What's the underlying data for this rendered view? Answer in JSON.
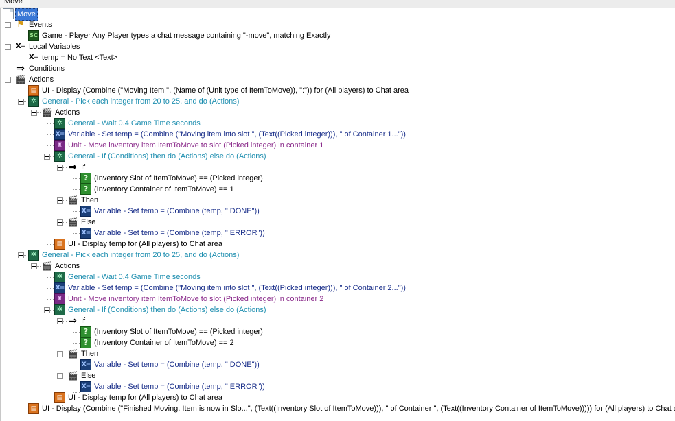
{
  "tab": {
    "label": "Move"
  },
  "tree": {
    "root": "Move",
    "events_label": "Events",
    "event_1": "Game - Player Any Player types a chat message containing \"-move\", matching Exactly",
    "local_vars_label": "Local Variables",
    "local_var_1": "temp = No Text <Text>",
    "conditions_label": "Conditions",
    "actions_label": "Actions",
    "a1": "UI - Display (Combine (\"Moving Item \", (Name of (Unit type of ItemToMove)), \":\")) for (All players) to Chat area",
    "loop1": "General - Pick each integer from 20 to 25, and do (Actions)",
    "loop1_actions": "Actions",
    "loop1_wait": "General - Wait 0.4 Game Time seconds",
    "loop1_set": "Variable - Set temp = (Combine (\"Moving item into slot \", (Text((Picked integer))), \" of Container 1...\"))",
    "loop1_move": "Unit - Move inventory item ItemToMove to slot (Picked integer) in container 1",
    "loop1_if": "General - If (Conditions) then do (Actions) else do (Actions)",
    "loop1_if_label": "If",
    "loop1_cond1": "(Inventory Slot of ItemToMove) == (Picked integer)",
    "loop1_cond2": "(Inventory Container of ItemToMove) == 1",
    "loop1_then_label": "Then",
    "loop1_then_set": "Variable - Set temp = (Combine (temp, \" DONE\"))",
    "loop1_else_label": "Else",
    "loop1_else_set": "Variable - Set temp = (Combine (temp, \" ERROR\"))",
    "loop1_display": "UI - Display temp for (All players) to Chat area",
    "loop2": "General - Pick each integer from 20 to 25, and do (Actions)",
    "loop2_actions": "Actions",
    "loop2_wait": "General - Wait 0.4 Game Time seconds",
    "loop2_set": "Variable - Set temp = (Combine (\"Moving item into slot \", (Text((Picked integer))), \" of Container 2...\"))",
    "loop2_move": "Unit - Move inventory item ItemToMove to slot (Picked integer) in container 2",
    "loop2_if": "General - If (Conditions) then do (Actions) else do (Actions)",
    "loop2_if_label": "If",
    "loop2_cond1": "(Inventory Slot of ItemToMove) == (Picked integer)",
    "loop2_cond2": "(Inventory Container of ItemToMove) == 2",
    "loop2_then_label": "Then",
    "loop2_then_set": "Variable - Set temp = (Combine (temp, \" DONE\"))",
    "loop2_else_label": "Else",
    "loop2_else_set": "Variable - Set temp = (Combine (temp, \" ERROR\"))",
    "loop2_display": "UI - Display temp for (All players) to Chat area",
    "final": "UI - Display (Combine (\"Finished Moving. Item is now in Slo...\", (Text((Inventory Slot of ItemToMove))), \" of Container \", (Text((Inventory Container of ItemToMove))))) for (All players) to Chat area"
  },
  "colors": {
    "default_text": "#000000",
    "general_text": "#1f8fb0",
    "variable_text": "#1a2f8a",
    "unit_text": "#8a2a8a",
    "selected_bg": "#3a78d6"
  },
  "icons": {
    "root": "trigger-document-icon",
    "events": "flag-icon",
    "event": "sc-event-icon",
    "local_vars": "variable-xeq-icon",
    "conditions": "arrow-icon",
    "actions": "clapper-icon",
    "ui": "ui-display-icon",
    "general": "general-gear-icon",
    "variable": "variable-set-icon",
    "unit": "unit-icon",
    "condition": "question-icon"
  }
}
